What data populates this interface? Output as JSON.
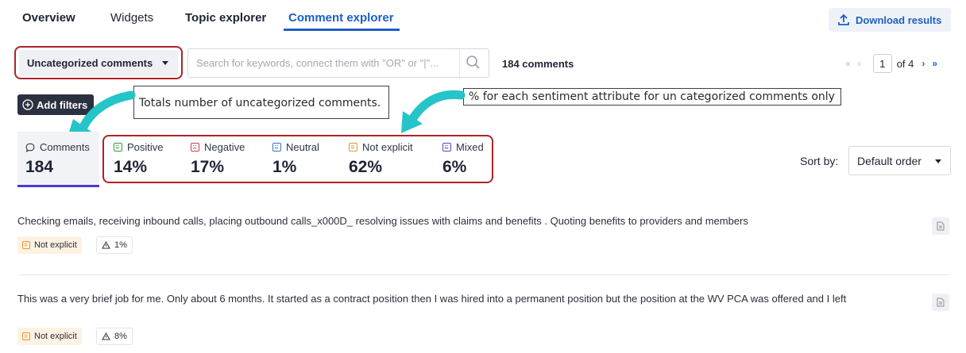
{
  "tabs": [
    {
      "label": "Overview"
    },
    {
      "label": "Widgets"
    },
    {
      "label": "Topic explorer"
    },
    {
      "label": "Comment explorer",
      "active": true
    }
  ],
  "download": {
    "label": "Download results",
    "icon": "upload-icon"
  },
  "filter": {
    "dropdown_value": "Uncategorized comments",
    "search_placeholder": "Search for keywords, connect them with \"OR\" or \"|\"...",
    "count_label": "184 comments"
  },
  "pagination": {
    "current": "1",
    "of_label": "of 4"
  },
  "add_filters": {
    "label": "Add filters"
  },
  "annotations": {
    "total_note": "Totals number of uncategorized comments.",
    "sentiment_note": "% for each sentiment attribute for un categorized comments only"
  },
  "stats": {
    "comments": {
      "label": "Comments",
      "value": "184"
    },
    "sentiments": [
      {
        "label": "Positive",
        "value": "14%",
        "color": "#3a9b3a",
        "icon": "smile-face-icon"
      },
      {
        "label": "Negative",
        "value": "17%",
        "color": "#c7413f",
        "icon": "frown-face-icon"
      },
      {
        "label": "Neutral",
        "value": "1%",
        "color": "#3573c4",
        "icon": "neutral-face-icon"
      },
      {
        "label": "Not explicit",
        "value": "62%",
        "color": "#e19a2c",
        "icon": "not-explicit-face-icon"
      },
      {
        "label": "Mixed",
        "value": "6%",
        "color": "#4a4fb8",
        "icon": "mixed-face-icon"
      }
    ]
  },
  "sort": {
    "label": "Sort by:",
    "value": "Default order"
  },
  "comments": [
    {
      "text": "Checking emails, receiving inbound calls, placing outbound calls_x000D_ resolving issues with claims and benefits . Quoting benefits to providers and members",
      "sentiment": "Not explicit",
      "warning": "1%"
    },
    {
      "text": "This was a very brief job for me. Only about 6 months. It started as a contract position then I was hired into a permanent position but the position at the WV PCA was offered and I left",
      "sentiment": "Not explicit",
      "warning": "8%"
    }
  ]
}
